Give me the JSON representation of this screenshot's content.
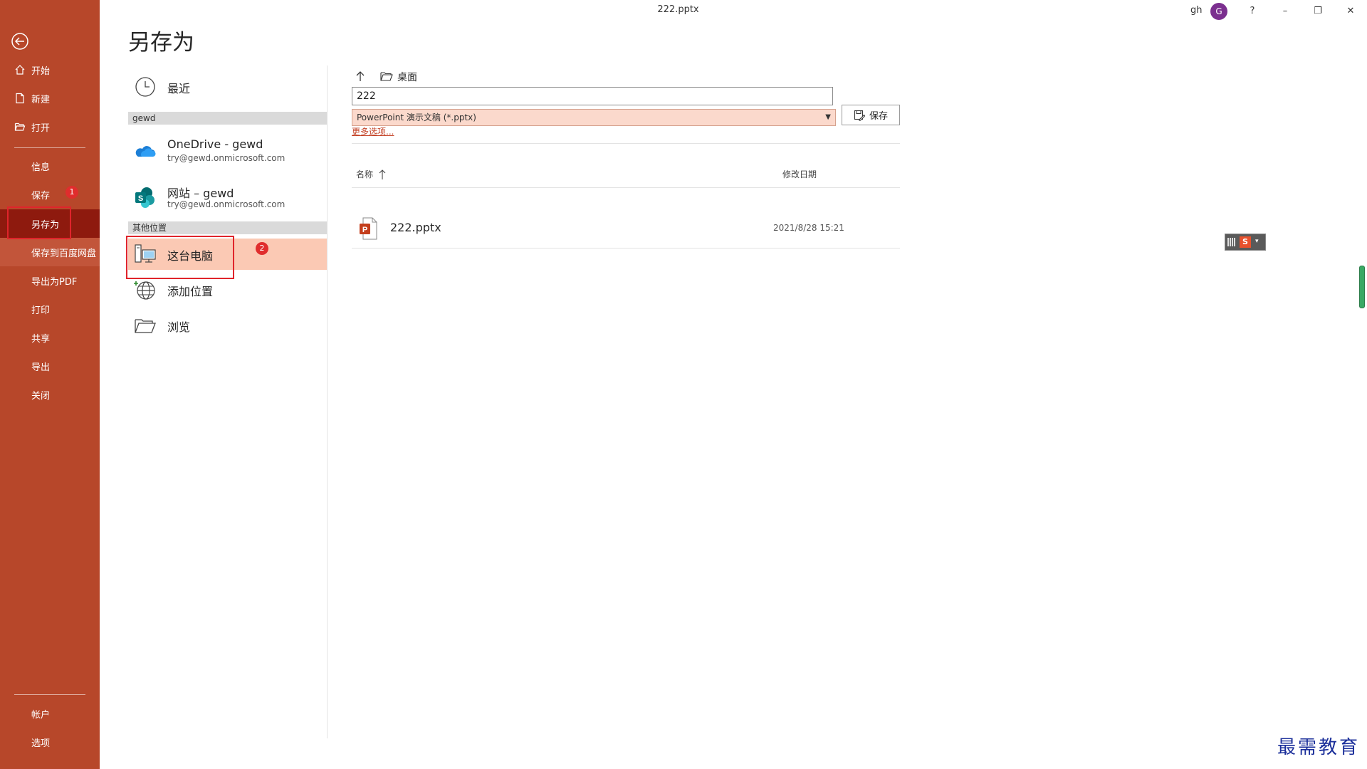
{
  "window": {
    "title": "222.pptx",
    "user_name": "gh",
    "avatar_initial": "G",
    "help": "?",
    "minimize": "–",
    "restore": "❐",
    "close": "✕"
  },
  "rail": {
    "back_icon": "back-arrow-icon",
    "items": [
      {
        "label": "开始",
        "icon": "home-icon"
      },
      {
        "label": "新建",
        "icon": "new-document-icon"
      },
      {
        "label": "打开",
        "icon": "folder-open-icon"
      },
      {
        "label": "信息"
      },
      {
        "label": "保存",
        "badge": "1"
      },
      {
        "label": "另存为",
        "active": true
      },
      {
        "label": "保存到百度网盘"
      },
      {
        "label": "导出为PDF"
      },
      {
        "label": "打印"
      },
      {
        "label": "共享"
      },
      {
        "label": "导出"
      },
      {
        "label": "关闭"
      }
    ],
    "bottom_items": [
      {
        "label": "帐户"
      },
      {
        "label": "选项"
      }
    ]
  },
  "page": {
    "title": "另存为"
  },
  "locations": {
    "recent": "最近",
    "group_gewd": "gewd",
    "onedrive": {
      "name": "OneDrive - gewd",
      "email": "try@gewd.onmicrosoft.com"
    },
    "sharepoint": {
      "name": "网站 – gewd",
      "email": "try@gewd.onmicrosoft.com"
    },
    "group_other": "其他位置",
    "this_pc": "这台电脑",
    "this_pc_badge": "2",
    "add_place": "添加位置",
    "browse": "浏览"
  },
  "save_panel": {
    "folder": "桌面",
    "filename": "222",
    "filetype": "PowerPoint 演示文稿 (*.pptx)",
    "more_options": "更多选项...",
    "save_button": "保存",
    "col_name": "名称",
    "col_modified": "修改日期",
    "files": [
      {
        "name": "222.pptx",
        "modified": "2021/8/28 15:21"
      }
    ]
  },
  "watermark": "最需教育",
  "colors": {
    "rail": "#b7472a",
    "rail_active": "#8e1a0e",
    "selected_location": "#fbc9b4",
    "filetype_bg": "#fbd9cc",
    "annotation_red": "#e0242b"
  }
}
